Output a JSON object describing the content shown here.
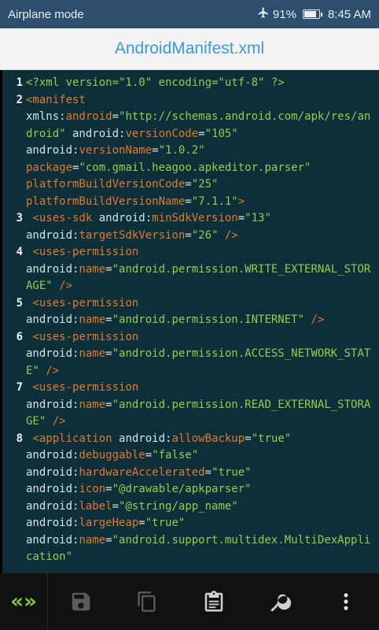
{
  "status_bar": {
    "left_text": "Airplane mode",
    "battery_percent": "91%",
    "time": "8:45 AM"
  },
  "title": "AndroidManifest.xml",
  "editor": {
    "lines": [
      {
        "number": "1",
        "segments": [
          {
            "t": "pi",
            "v": "<?xml version=\"1.0\" encoding=\"utf-8\" ?>"
          }
        ]
      },
      {
        "number": "2",
        "segments": [
          {
            "t": "tag",
            "v": "<manifest"
          },
          {
            "t": "ns",
            "v": "\nxmlns:"
          },
          {
            "t": "attr",
            "v": "android"
          },
          {
            "t": "ns",
            "v": "="
          },
          {
            "t": "str",
            "v": "\"http://schemas.android.com/apk/res/android\""
          },
          {
            "t": "ns",
            "v": " android:"
          },
          {
            "t": "attr",
            "v": "versionCode"
          },
          {
            "t": "ns",
            "v": "="
          },
          {
            "t": "str",
            "v": "\"105\""
          },
          {
            "t": "ns",
            "v": "\nandroid:"
          },
          {
            "t": "attr",
            "v": "versionName"
          },
          {
            "t": "ns",
            "v": "="
          },
          {
            "t": "str",
            "v": "\"1.0.2\""
          },
          {
            "t": "ns",
            "v": "\n"
          },
          {
            "t": "attr",
            "v": "package"
          },
          {
            "t": "ns",
            "v": "="
          },
          {
            "t": "str",
            "v": "\"com.gmail.heagoo.apkeditor.parser\""
          },
          {
            "t": "ns",
            "v": "\n"
          },
          {
            "t": "attr",
            "v": "platformBuildVersionCode"
          },
          {
            "t": "ns",
            "v": "="
          },
          {
            "t": "str",
            "v": "\"25\""
          },
          {
            "t": "ns",
            "v": "\n"
          },
          {
            "t": "attr",
            "v": "platformBuildVersionName"
          },
          {
            "t": "ns",
            "v": "="
          },
          {
            "t": "str",
            "v": "\"7.1.1\""
          },
          {
            "t": "tag",
            "v": ">"
          }
        ]
      },
      {
        "number": "3",
        "segments": [
          {
            "t": "tag",
            "v": " <uses-sdk"
          },
          {
            "t": "ns",
            "v": " android:"
          },
          {
            "t": "attr",
            "v": "minSdkVersion"
          },
          {
            "t": "ns",
            "v": "="
          },
          {
            "t": "str",
            "v": "\"13\""
          },
          {
            "t": "ns",
            "v": "\nandroid:"
          },
          {
            "t": "attr",
            "v": "targetSdkVersion"
          },
          {
            "t": "ns",
            "v": "="
          },
          {
            "t": "str",
            "v": "\"26\""
          },
          {
            "t": "tag",
            "v": " />"
          }
        ]
      },
      {
        "number": "4",
        "segments": [
          {
            "t": "tag",
            "v": " <uses-permission"
          },
          {
            "t": "ns",
            "v": "\nandroid:"
          },
          {
            "t": "attr",
            "v": "name"
          },
          {
            "t": "ns",
            "v": "="
          },
          {
            "t": "str",
            "v": "\"android.permission.WRITE_EXTERNAL_STORAGE\""
          },
          {
            "t": "tag",
            "v": " />"
          }
        ]
      },
      {
        "number": "5",
        "segments": [
          {
            "t": "tag",
            "v": " <uses-permission"
          },
          {
            "t": "ns",
            "v": "\nandroid:"
          },
          {
            "t": "attr",
            "v": "name"
          },
          {
            "t": "ns",
            "v": "="
          },
          {
            "t": "str",
            "v": "\"android.permission.INTERNET\""
          },
          {
            "t": "tag",
            "v": " />"
          }
        ]
      },
      {
        "number": "6",
        "segments": [
          {
            "t": "tag",
            "v": " <uses-permission"
          },
          {
            "t": "ns",
            "v": "\nandroid:"
          },
          {
            "t": "attr",
            "v": "name"
          },
          {
            "t": "ns",
            "v": "="
          },
          {
            "t": "str",
            "v": "\"android.permission.ACCESS_NETWORK_STATE\""
          },
          {
            "t": "tag",
            "v": " />"
          }
        ]
      },
      {
        "number": "7",
        "segments": [
          {
            "t": "tag",
            "v": " <uses-permission"
          },
          {
            "t": "ns",
            "v": "\nandroid:"
          },
          {
            "t": "attr",
            "v": "name"
          },
          {
            "t": "ns",
            "v": "="
          },
          {
            "t": "str",
            "v": "\"android.permission.READ_EXTERNAL_STORAGE\""
          },
          {
            "t": "tag",
            "v": " />"
          }
        ]
      },
      {
        "number": "8",
        "segments": [
          {
            "t": "tag",
            "v": " <application"
          },
          {
            "t": "ns",
            "v": " android:"
          },
          {
            "t": "attr",
            "v": "allowBackup"
          },
          {
            "t": "ns",
            "v": "="
          },
          {
            "t": "str",
            "v": "\"true\""
          },
          {
            "t": "ns",
            "v": "\nandroid:"
          },
          {
            "t": "attr",
            "v": "debuggable"
          },
          {
            "t": "ns",
            "v": "="
          },
          {
            "t": "str",
            "v": "\"false\""
          },
          {
            "t": "ns",
            "v": "\nandroid:"
          },
          {
            "t": "attr",
            "v": "hardwareAccelerated"
          },
          {
            "t": "ns",
            "v": "="
          },
          {
            "t": "str",
            "v": "\"true\""
          },
          {
            "t": "ns",
            "v": "\nandroid:"
          },
          {
            "t": "attr",
            "v": "icon"
          },
          {
            "t": "ns",
            "v": "="
          },
          {
            "t": "str",
            "v": "\"@drawable/apkparser\""
          },
          {
            "t": "ns",
            "v": "\nandroid:"
          },
          {
            "t": "attr",
            "v": "label"
          },
          {
            "t": "ns",
            "v": "="
          },
          {
            "t": "str",
            "v": "\"@string/app_name\""
          },
          {
            "t": "ns",
            "v": "\nandroid:"
          },
          {
            "t": "attr",
            "v": "largeHeap"
          },
          {
            "t": "ns",
            "v": "="
          },
          {
            "t": "str",
            "v": "\"true\""
          },
          {
            "t": "ns",
            "v": "\nandroid:"
          },
          {
            "t": "attr",
            "v": "name"
          },
          {
            "t": "ns",
            "v": "="
          },
          {
            "t": "str",
            "v": "\"android.support.multidex.MultiDexApplication\""
          }
        ]
      }
    ]
  },
  "toolbar": {
    "nav_label": "«»",
    "buttons": [
      "save-icon",
      "copy-icon",
      "clipboard-icon",
      "search-icon",
      "more-vert-icon"
    ]
  },
  "colors": {
    "status_bar": "#2d4f6d",
    "title_text": "#3d9ad6",
    "editor_bg": "#0c2f3a",
    "tag": "#e07a2f",
    "string": "#8fcf4d",
    "plain": "#d7e3e3",
    "nav_accent": "#7dcf3a"
  }
}
